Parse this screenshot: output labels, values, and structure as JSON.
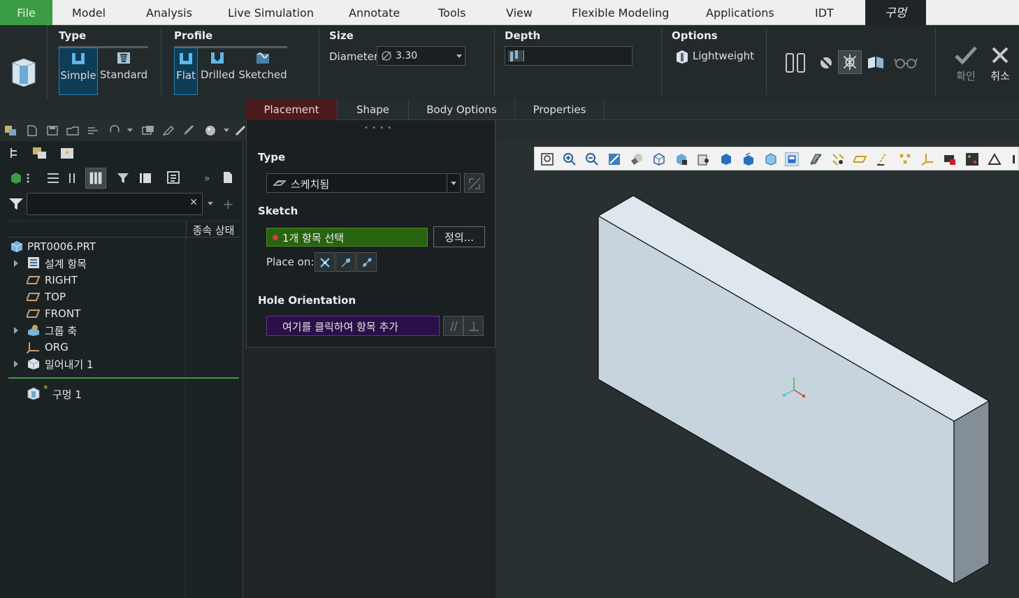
{
  "menu": {
    "items": [
      "File",
      "Model",
      "Analysis",
      "Live Simulation",
      "Annotate",
      "Tools",
      "View",
      "Flexible Modeling",
      "Applications",
      "IDT",
      "구멍"
    ]
  },
  "ribbon": {
    "type": {
      "label": "Type",
      "simple": "Simple",
      "standard": "Standard"
    },
    "profile": {
      "label": "Profile",
      "flat": "Flat",
      "drilled": "Drilled",
      "sketched": "Sketched"
    },
    "size": {
      "label": "Size",
      "diameter_label": "Diameter:",
      "diameter_value": "3.30"
    },
    "depth": {
      "label": "Depth",
      "value": ""
    },
    "options": {
      "label": "Options",
      "lightweight": "Lightweight"
    },
    "confirm": "확인",
    "cancel": "취소"
  },
  "dashboard_tabs": [
    "Placement",
    "Shape",
    "Body Options",
    "Properties"
  ],
  "placement": {
    "type_label": "Type",
    "type_value": "스케치됨",
    "sketch_label": "Sketch",
    "sketch_value": "1개 항목 선택",
    "define_button": "정의...",
    "place_on_label": "Place on:",
    "orientation_label": "Hole Orientation",
    "orientation_placeholder": "여기를 클릭하여 항목 추가"
  },
  "model_tree": {
    "filter_placeholder": "",
    "column_header": "종속 상태",
    "items": [
      {
        "label": "PRT0006.PRT",
        "icon": "part-icon"
      },
      {
        "label": "설계 항목",
        "icon": "design-items-icon"
      },
      {
        "label": "RIGHT",
        "icon": "datum-plane-icon"
      },
      {
        "label": "TOP",
        "icon": "datum-plane-icon"
      },
      {
        "label": "FRONT",
        "icon": "datum-plane-icon"
      },
      {
        "label": "그룹 축",
        "icon": "group-axis-icon"
      },
      {
        "label": "ORG",
        "icon": "csys-icon"
      },
      {
        "label": "밀어내기 1",
        "icon": "extrude-icon"
      },
      {
        "label": "구멍 1",
        "icon": "hole-feature-icon",
        "marker": "*"
      }
    ]
  },
  "colors": {
    "file_tab": "#3a9c43",
    "selected_tab": "#4b1a1a",
    "sketch_selected": "#28630f",
    "orientation_box": "#2a0f48",
    "model_face": "#c9d4de"
  }
}
